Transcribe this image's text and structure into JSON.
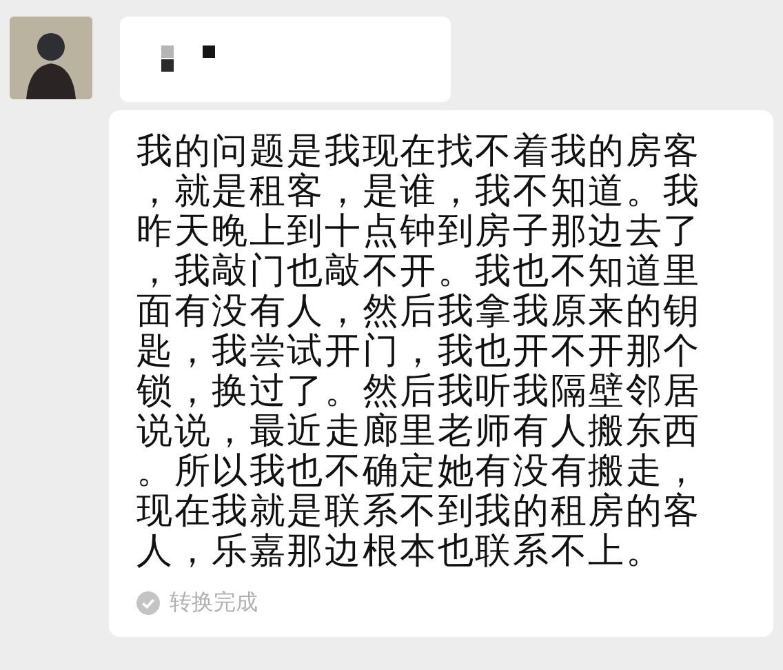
{
  "messages": [
    {
      "kind": "voice"
    },
    {
      "kind": "transcript",
      "text": "我的问题是我现在找不着我的房客，就是租客，是谁，我不知道。我昨天晚上到十点钟到房子那边去了，我敲门也敲不开。我也不知道里面有没有人，然后我拿我原来的钥匙，我尝试开门，我也开不开那个锁，换过了。然后我听我隔壁邻居说说，最近走廊里老师有人搬东西。所以我也不确定她有没有搬走，现在我就是联系不到我的租房的客人，乐嘉那边根本也联系不上。",
      "status": "转换完成"
    }
  ]
}
